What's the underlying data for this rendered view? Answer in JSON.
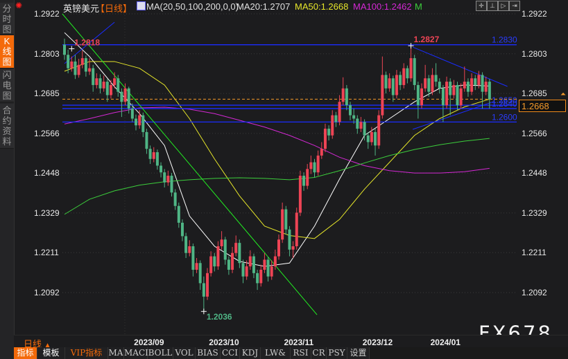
{
  "sidebar": {
    "tabs": [
      {
        "label": "分时图",
        "active": false
      },
      {
        "label": "K线图",
        "active": true
      },
      {
        "label": "闪电图",
        "active": false
      },
      {
        "label": "合约资料",
        "active": false
      }
    ]
  },
  "header": {
    "symbol": "英镑美元",
    "period": "【日线】",
    "ma_params": "MA(20,50,100,200,0,0)",
    "ma20": "MA20:1.2707",
    "ma50": "MA50:1.2668",
    "ma100": "MA100:1.2462",
    "ma200": "M",
    "tools": [
      "crosshair-icon",
      "zoom-range-icon",
      "step-icon",
      "exit-icon"
    ]
  },
  "colors": {
    "up": "#ee4455",
    "down": "#4fb585",
    "ma20": "#ffffff",
    "ma50": "#e6e62a",
    "ma100": "#d428d4",
    "ma200": "#3ccf3c",
    "trendline_blue": "#1a2cff",
    "trendline_green": "#22ee22",
    "accent": "#f46a0a",
    "current_price": "#f59a2a"
  },
  "current_price": "1.2668",
  "watermark": "FX678",
  "period_selector": "日线",
  "toolbar": [
    "指标",
    "模板",
    "VIP指标",
    "MA",
    "MACD",
    "BOLL",
    "VOL",
    "BIAS",
    "CCI",
    "KDJ",
    "LW&",
    "RSI",
    "CR",
    "PSY",
    "设置"
  ],
  "chart_data": {
    "type": "candlestick",
    "ylim": [
      1.2092,
      1.2922
    ],
    "y_ticks": [
      "1.2922",
      "1.2803",
      "1.2685",
      "1.2566",
      "1.2448",
      "1.2329",
      "1.2211",
      "1.2092"
    ],
    "x_ticks": [
      {
        "label": "2023/09",
        "index": 21
      },
      {
        "label": "2023/10",
        "index": 42
      },
      {
        "label": "2023/11",
        "index": 63
      },
      {
        "label": "2023/12",
        "index": 85
      },
      {
        "label": "2024/01",
        "index": 104
      }
    ],
    "grid": true,
    "ohlc": [
      [
        1.283,
        1.2848,
        1.2785,
        1.28
      ],
      [
        1.28,
        1.2815,
        1.2745,
        1.276
      ],
      [
        1.276,
        1.2795,
        1.275,
        1.278
      ],
      [
        1.278,
        1.28,
        1.2728,
        1.274
      ],
      [
        1.274,
        1.2788,
        1.2732,
        1.277
      ],
      [
        1.277,
        1.2812,
        1.276,
        1.279
      ],
      [
        1.279,
        1.2798,
        1.2735,
        1.275
      ],
      [
        1.275,
        1.279,
        1.274,
        1.276
      ],
      [
        1.276,
        1.277,
        1.269,
        1.271
      ],
      [
        1.271,
        1.2745,
        1.27,
        1.273
      ],
      [
        1.273,
        1.2742,
        1.2685,
        1.27
      ],
      [
        1.27,
        1.2738,
        1.269,
        1.272
      ],
      [
        1.272,
        1.2728,
        1.266,
        1.268
      ],
      [
        1.268,
        1.2725,
        1.267,
        1.271
      ],
      [
        1.271,
        1.2748,
        1.27,
        1.273
      ],
      [
        1.273,
        1.274,
        1.2675,
        1.269
      ],
      [
        1.269,
        1.27,
        1.2615,
        1.266
      ],
      [
        1.266,
        1.2715,
        1.265,
        1.27
      ],
      [
        1.27,
        1.2705,
        1.2625,
        1.264
      ],
      [
        1.264,
        1.2655,
        1.26,
        1.261
      ],
      [
        1.261,
        1.2622,
        1.2575,
        1.259
      ],
      [
        1.259,
        1.2635,
        1.258,
        1.262
      ],
      [
        1.262,
        1.2628,
        1.2555,
        1.257
      ],
      [
        1.257,
        1.258,
        1.2505,
        1.252
      ],
      [
        1.252,
        1.253,
        1.2475,
        1.249
      ],
      [
        1.249,
        1.2525,
        1.248,
        1.251
      ],
      [
        1.251,
        1.2518,
        1.2458,
        1.247
      ],
      [
        1.247,
        1.248,
        1.2435,
        1.245
      ],
      [
        1.245,
        1.246,
        1.2405,
        1.242
      ],
      [
        1.242,
        1.2455,
        1.241,
        1.244
      ],
      [
        1.244,
        1.2448,
        1.2378,
        1.239
      ],
      [
        1.239,
        1.24,
        1.2338,
        1.235
      ],
      [
        1.235,
        1.236,
        1.2285,
        1.23
      ],
      [
        1.23,
        1.231,
        1.2245,
        1.226
      ],
      [
        1.226,
        1.227,
        1.2195,
        1.221
      ],
      [
        1.221,
        1.2248,
        1.22,
        1.223
      ],
      [
        1.223,
        1.2238,
        1.214,
        1.216
      ],
      [
        1.216,
        1.2195,
        1.215,
        1.218
      ],
      [
        1.218,
        1.2188,
        1.21,
        1.212
      ],
      [
        1.212,
        1.214,
        1.2036,
        1.208
      ],
      [
        1.208,
        1.2165,
        1.207,
        1.215
      ],
      [
        1.215,
        1.2215,
        1.214,
        1.22
      ],
      [
        1.22,
        1.221,
        1.2155,
        1.217
      ],
      [
        1.217,
        1.2245,
        1.216,
        1.223
      ],
      [
        1.223,
        1.2275,
        1.222,
        1.225
      ],
      [
        1.225,
        1.2258,
        1.2175,
        1.219
      ],
      [
        1.219,
        1.22,
        1.2145,
        1.216
      ],
      [
        1.216,
        1.2228,
        1.215,
        1.221
      ],
      [
        1.221,
        1.2262,
        1.22,
        1.224
      ],
      [
        1.224,
        1.225,
        1.2165,
        1.218
      ],
      [
        1.218,
        1.219,
        1.212,
        1.214
      ],
      [
        1.214,
        1.2188,
        1.213,
        1.217
      ],
      [
        1.217,
        1.2218,
        1.216,
        1.22
      ],
      [
        1.22,
        1.2208,
        1.2135,
        1.215
      ],
      [
        1.215,
        1.216,
        1.21,
        1.212
      ],
      [
        1.212,
        1.2175,
        1.211,
        1.216
      ],
      [
        1.216,
        1.221,
        1.215,
        1.219
      ],
      [
        1.219,
        1.2198,
        1.2125,
        1.214
      ],
      [
        1.214,
        1.2188,
        1.213,
        1.217
      ],
      [
        1.217,
        1.222,
        1.216,
        1.22
      ],
      [
        1.22,
        1.2265,
        1.219,
        1.225
      ],
      [
        1.225,
        1.236,
        1.224,
        1.234
      ],
      [
        1.234,
        1.235,
        1.2265,
        1.228
      ],
      [
        1.228,
        1.229,
        1.22,
        1.222
      ],
      [
        1.222,
        1.2245,
        1.2195,
        1.223
      ],
      [
        1.223,
        1.2345,
        1.222,
        1.233
      ],
      [
        1.233,
        1.2455,
        1.232,
        1.244
      ],
      [
        1.244,
        1.245,
        1.2395,
        1.241
      ],
      [
        1.241,
        1.2475,
        1.24,
        1.246
      ],
      [
        1.246,
        1.25,
        1.2445,
        1.248
      ],
      [
        1.248,
        1.249,
        1.2435,
        1.245
      ],
      [
        1.245,
        1.2515,
        1.244,
        1.25
      ],
      [
        1.25,
        1.254,
        1.249,
        1.252
      ],
      [
        1.252,
        1.2595,
        1.251,
        1.258
      ],
      [
        1.258,
        1.259,
        1.2545,
        1.256
      ],
      [
        1.256,
        1.2635,
        1.255,
        1.262
      ],
      [
        1.262,
        1.263,
        1.2585,
        1.26
      ],
      [
        1.26,
        1.268,
        1.259,
        1.266
      ],
      [
        1.266,
        1.2733,
        1.265,
        1.27
      ],
      [
        1.27,
        1.271,
        1.2635,
        1.265
      ],
      [
        1.265,
        1.266,
        1.2605,
        1.262
      ],
      [
        1.262,
        1.264,
        1.2595,
        1.261
      ],
      [
        1.261,
        1.262,
        1.2565,
        1.258
      ],
      [
        1.258,
        1.2615,
        1.257,
        1.26
      ],
      [
        1.26,
        1.2608,
        1.2545,
        1.256
      ],
      [
        1.256,
        1.257,
        1.252,
        1.254
      ],
      [
        1.254,
        1.2585,
        1.253,
        1.257
      ],
      [
        1.257,
        1.258,
        1.25,
        1.253
      ],
      [
        1.253,
        1.2635,
        1.252,
        1.262
      ],
      [
        1.262,
        1.2795,
        1.261,
        1.274
      ],
      [
        1.274,
        1.275,
        1.2685,
        1.27
      ],
      [
        1.27,
        1.2745,
        1.269,
        1.273
      ],
      [
        1.273,
        1.2738,
        1.266,
        1.268
      ],
      [
        1.268,
        1.2755,
        1.267,
        1.274
      ],
      [
        1.274,
        1.275,
        1.2695,
        1.271
      ],
      [
        1.271,
        1.2775,
        1.27,
        1.276
      ],
      [
        1.276,
        1.2768,
        1.2715,
        1.273
      ],
      [
        1.273,
        1.2827,
        1.272,
        1.279
      ],
      [
        1.279,
        1.28,
        1.2695,
        1.271
      ],
      [
        1.271,
        1.272,
        1.261,
        1.265
      ],
      [
        1.265,
        1.2715,
        1.264,
        1.27
      ],
      [
        1.27,
        1.277,
        1.269,
        1.273
      ],
      [
        1.273,
        1.274,
        1.2675,
        1.269
      ],
      [
        1.269,
        1.276,
        1.268,
        1.274
      ],
      [
        1.274,
        1.2775,
        1.2705,
        1.272
      ],
      [
        1.272,
        1.273,
        1.2685,
        1.27
      ],
      [
        1.27,
        1.271,
        1.26,
        1.265
      ],
      [
        1.265,
        1.2735,
        1.264,
        1.272
      ],
      [
        1.272,
        1.273,
        1.262,
        1.268
      ],
      [
        1.268,
        1.2725,
        1.267,
        1.271
      ],
      [
        1.271,
        1.272,
        1.2635,
        1.265
      ],
      [
        1.265,
        1.2715,
        1.264,
        1.27
      ],
      [
        1.27,
        1.2765,
        1.269,
        1.272
      ],
      [
        1.272,
        1.273,
        1.2675,
        1.269
      ],
      [
        1.269,
        1.2745,
        1.268,
        1.273
      ],
      [
        1.273,
        1.274,
        1.2695,
        1.271
      ],
      [
        1.271,
        1.2752,
        1.27,
        1.274
      ],
      [
        1.274,
        1.2748,
        1.264,
        1.269
      ],
      [
        1.269,
        1.2735,
        1.268,
        1.272
      ],
      [
        1.272,
        1.2728,
        1.264,
        1.2668
      ]
    ],
    "ma_sample_indices": [
      0,
      7,
      14,
      21,
      28,
      35,
      42,
      49,
      56,
      63,
      70,
      77,
      84,
      91,
      98,
      105,
      112,
      119
    ],
    "series": [
      {
        "name": "MA20",
        "color_key": "ma20",
        "values": [
          1.2866,
          1.2795,
          1.2705,
          1.2625,
          1.253,
          1.232,
          1.223,
          1.2185,
          1.217,
          1.218,
          1.229,
          1.243,
          1.256,
          1.261,
          1.266,
          1.27,
          1.271,
          1.2707
        ]
      },
      {
        "name": "MA50",
        "color_key": "ma50",
        "values": [
          1.2751,
          1.278,
          1.278,
          1.276,
          1.271,
          1.261,
          1.249,
          1.238,
          1.229,
          1.2262,
          1.2253,
          1.231,
          1.24,
          1.248,
          1.256,
          1.261,
          1.2645,
          1.2668
        ]
      },
      {
        "name": "MA100",
        "color_key": "ma100",
        "values": [
          1.2594,
          1.261,
          1.2628,
          1.2642,
          1.2644,
          1.2638,
          1.2625,
          1.2605,
          1.2585,
          1.256,
          1.253,
          1.2495,
          1.247,
          1.2455,
          1.2448,
          1.2448,
          1.2452,
          1.2462
        ]
      },
      {
        "name": "M",
        "color_key": "ma200",
        "values": [
          1.2325,
          1.237,
          1.2395,
          1.2412,
          1.2422,
          1.2428,
          1.2432,
          1.2434,
          1.2432,
          1.2428,
          1.2435,
          1.2455,
          1.2478,
          1.25,
          1.2518,
          1.2532,
          1.2543,
          1.2551
        ]
      }
    ],
    "horizontal_lines": [
      {
        "price": 1.283,
        "label": "1.2830"
      },
      {
        "price": 1.265,
        "label": "1.2650"
      },
      {
        "price": 1.264,
        "label": "1.2640"
      },
      {
        "price": 1.26,
        "label": "1.2600"
      }
    ],
    "current_price_line": 1.2668,
    "trendlines": [
      {
        "color_key": "trendline_green",
        "from": [
          -0.6,
          1.2922
        ],
        "to": [
          70.7,
          1.2026
        ]
      },
      {
        "color_key": "trendline_blue",
        "from": [
          0,
          1.2774
        ],
        "to": [
          14,
          1.2897
        ]
      },
      {
        "color_key": "trendline_blue",
        "from": [
          97.5,
          1.2823
        ],
        "to": [
          124,
          1.2706
        ]
      },
      {
        "color_key": "trendline_blue",
        "from": [
          97.5,
          1.2578
        ],
        "to": [
          120,
          1.266
        ]
      }
    ],
    "annotations": [
      {
        "text": "1.2818",
        "index": 2,
        "price": 1.2818,
        "color_key": "up"
      },
      {
        "text": "1.2827",
        "index": 97,
        "price": 1.2827,
        "color_key": "up"
      },
      {
        "text": "1.2036",
        "index": 39,
        "price": 1.2036,
        "color_key": "down"
      }
    ]
  }
}
